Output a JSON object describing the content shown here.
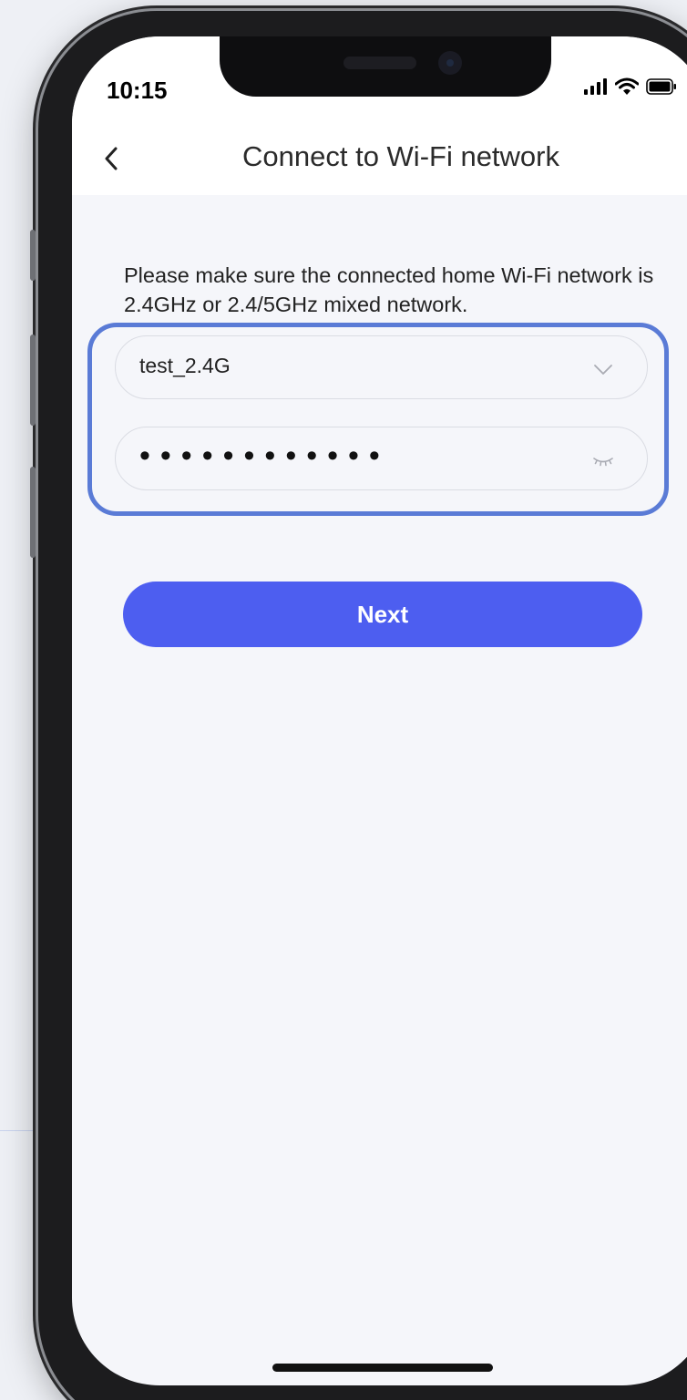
{
  "status_bar": {
    "time": "10:15",
    "icons": [
      "signal-icon",
      "wifi-icon",
      "battery-icon"
    ]
  },
  "nav": {
    "back_icon": "chevron-left-icon",
    "title": "Connect to Wi-Fi network"
  },
  "notice": {
    "text": "Please make sure the connected home Wi-Fi network is 2.4GHz or 2.4/5GHz mixed network."
  },
  "wifi_form": {
    "ssid_value": "test_2.4G",
    "ssid_dropdown_icon": "chevron-down-icon",
    "password_masked": "••••••••••••",
    "password_toggle_icon": "eye-closed-icon"
  },
  "actions": {
    "next_label": "Next"
  },
  "colors": {
    "accent": "#4d5ef0",
    "highlight_outline": "#5a7bd6",
    "screen_background": "#f5f6fa"
  }
}
